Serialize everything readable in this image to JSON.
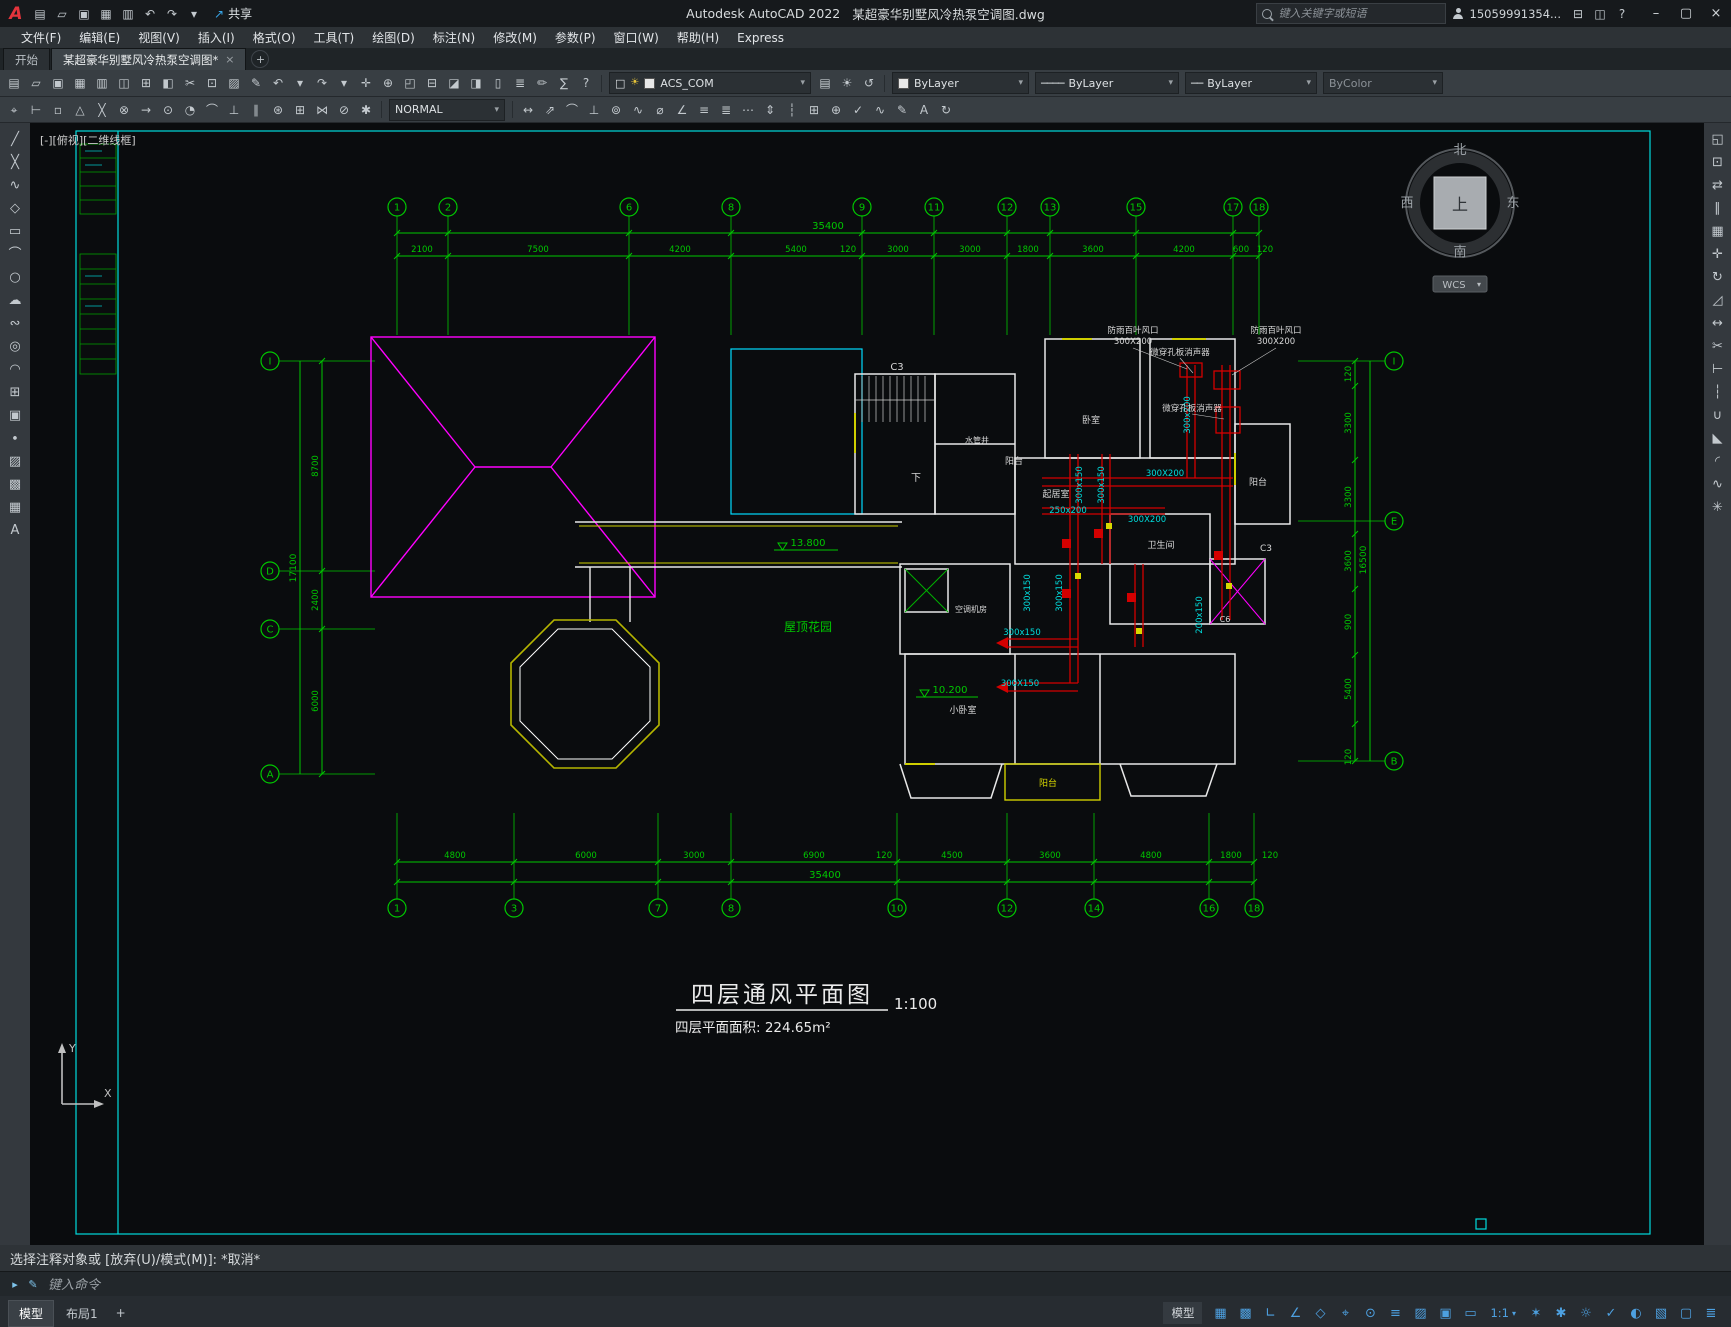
{
  "titlebar": {
    "logo_letter": "A",
    "qat_icons": [
      {
        "name": "qnew-icon",
        "glyph": "▤"
      },
      {
        "name": "open-folder-icon",
        "glyph": "▱"
      },
      {
        "name": "save-icon",
        "glyph": "▣"
      },
      {
        "name": "save-all-icon",
        "glyph": "▦"
      },
      {
        "name": "plot-icon",
        "glyph": "▥"
      },
      {
        "name": "undo-icon",
        "glyph": "↶"
      },
      {
        "name": "redo-icon",
        "glyph": "↷"
      },
      {
        "name": "qat-menu-caret-icon",
        "glyph": "▾"
      }
    ],
    "share_icon_glyph": "↗",
    "share_label": "共享",
    "app_name": "Autodesk AutoCAD 2022",
    "doc_name": "某超豪华别墅风冷热泵空调图.dwg",
    "search_placeholder": "键入关键字或短语",
    "username": "15059991354...",
    "account_icons": [
      {
        "name": "cart-icon",
        "glyph": "⊟"
      },
      {
        "name": "apps-icon",
        "glyph": "◫"
      },
      {
        "name": "help-icon",
        "glyph": "?"
      }
    ],
    "window_buttons": [
      {
        "name": "minimize-button",
        "glyph": "–"
      },
      {
        "name": "maximize-button",
        "glyph": "▢"
      },
      {
        "name": "close-button",
        "glyph": "×"
      }
    ]
  },
  "menubar": {
    "items": [
      "文件(F)",
      "编辑(E)",
      "视图(V)",
      "插入(I)",
      "格式(O)",
      "工具(T)",
      "绘图(D)",
      "标注(N)",
      "修改(M)",
      "参数(P)",
      "窗口(W)",
      "帮助(H)",
      "Express"
    ]
  },
  "filetabs": {
    "start_tab": "开始",
    "doc_tab": "某超豪华别墅风冷热泵空调图*",
    "close_glyph": "×",
    "new_tab_glyph": "+"
  },
  "toolbar1": {
    "icons": [
      {
        "name": "qnew-icon",
        "glyph": "▤"
      },
      {
        "name": "open-icon",
        "glyph": "▱"
      },
      {
        "name": "save-icon",
        "glyph": "▣"
      },
      {
        "name": "save-as-icon",
        "glyph": "▦"
      },
      {
        "name": "plot-icon",
        "glyph": "▥"
      },
      {
        "name": "plot-preview-icon",
        "glyph": "◫"
      },
      {
        "name": "publish-icon",
        "glyph": "⊞"
      },
      {
        "name": "etransmit-icon",
        "glyph": "◧"
      },
      {
        "name": "cut-icon",
        "glyph": "✂"
      },
      {
        "name": "copy-clip-icon",
        "glyph": "⊡"
      },
      {
        "name": "paste-icon",
        "glyph": "▨"
      },
      {
        "name": "match-properties-icon",
        "glyph": "✎"
      },
      {
        "name": "undo-icon",
        "glyph": "↶"
      },
      {
        "name": "undo-caret-icon",
        "glyph": "▾"
      },
      {
        "name": "redo-icon",
        "glyph": "↷"
      },
      {
        "name": "redo-caret-icon",
        "glyph": "▾"
      },
      {
        "name": "pan-icon",
        "glyph": "✛"
      },
      {
        "name": "zoom-realtime-icon",
        "glyph": "⊕"
      },
      {
        "name": "zoom-window-icon",
        "glyph": "◰"
      },
      {
        "name": "zoom-previous-icon",
        "glyph": "⊟"
      },
      {
        "name": "properties-icon",
        "glyph": "◪"
      },
      {
        "name": "designcenter-icon",
        "glyph": "◨"
      },
      {
        "name": "tool-palettes-icon",
        "glyph": "▯"
      },
      {
        "name": "sheet-set-manager-icon",
        "glyph": "≣"
      },
      {
        "name": "markup-icon",
        "glyph": "✏"
      },
      {
        "name": "quickcalc-icon",
        "glyph": "∑"
      },
      {
        "name": "help-icon",
        "glyph": "?"
      }
    ],
    "layer_combo": {
      "checkbox_glyph": "□",
      "sun_glyph": "☀",
      "label": "ACS_COM",
      "caret": "▾"
    },
    "layer_tool_icons": [
      {
        "name": "layer-properties-icon",
        "glyph": "▤"
      },
      {
        "name": "layer-states-icon",
        "glyph": "☀"
      },
      {
        "name": "layer-previous-icon",
        "glyph": "↺"
      }
    ],
    "color_combo": {
      "label": "ByLayer",
      "caret": "▾"
    },
    "linetype_combo": {
      "sample": "────",
      "label": "ByLayer",
      "caret": "▾"
    },
    "lineweight_combo": {
      "sample": "──",
      "label": "ByLayer",
      "caret": "▾"
    },
    "plotstyle_combo": {
      "label": "ByColor",
      "caret": "▾"
    }
  },
  "toolbar2": {
    "osnap_icons": [
      {
        "name": "temporary-track-icon",
        "glyph": "⌖"
      },
      {
        "name": "snap-from-icon",
        "glyph": "⊢"
      },
      {
        "name": "snap-endpoint-icon",
        "glyph": "▫"
      },
      {
        "name": "snap-midpoint-icon",
        "glyph": "△"
      },
      {
        "name": "snap-intersection-icon",
        "glyph": "╳"
      },
      {
        "name": "snap-apparent-icon",
        "glyph": "⊗"
      },
      {
        "name": "snap-extension-icon",
        "glyph": "→"
      },
      {
        "name": "snap-center-icon",
        "glyph": "⊙"
      },
      {
        "name": "snap-quadrant-icon",
        "glyph": "◔"
      },
      {
        "name": "snap-tangent-icon",
        "glyph": "⌒"
      },
      {
        "name": "snap-perpendicular-icon",
        "glyph": "⊥"
      },
      {
        "name": "snap-parallel-icon",
        "glyph": "∥"
      },
      {
        "name": "snap-node-icon",
        "glyph": "⊛"
      },
      {
        "name": "snap-insert-icon",
        "glyph": "⊞"
      },
      {
        "name": "snap-nearest-icon",
        "glyph": "⋈"
      },
      {
        "name": "snap-none-icon",
        "glyph": "⊘"
      },
      {
        "name": "osnap-settings-icon",
        "glyph": "✱"
      }
    ],
    "textstyle_combo": {
      "label": "NORMAL",
      "caret": "▾"
    },
    "dim_icons": [
      {
        "name": "dim-linear-icon",
        "glyph": "↔"
      },
      {
        "name": "dim-aligned-icon",
        "glyph": "⇗"
      },
      {
        "name": "dim-arc-length-icon",
        "glyph": "⌒"
      },
      {
        "name": "dim-ordinate-icon",
        "glyph": "⊥"
      },
      {
        "name": "dim-radius-icon",
        "glyph": "⊚"
      },
      {
        "name": "dim-jogged-icon",
        "glyph": "∿"
      },
      {
        "name": "dim-diameter-icon",
        "glyph": "⌀"
      },
      {
        "name": "dim-angular-icon",
        "glyph": "∠"
      },
      {
        "name": "quick-dim-icon",
        "glyph": "≡"
      },
      {
        "name": "dim-baseline-icon",
        "glyph": "≣"
      },
      {
        "name": "dim-continue-icon",
        "glyph": "⋯"
      },
      {
        "name": "dim-space-icon",
        "glyph": "⇕"
      },
      {
        "name": "dim-break-icon",
        "glyph": "┆"
      },
      {
        "name": "tolerance-icon",
        "glyph": "⊞"
      },
      {
        "name": "center-mark-icon",
        "glyph": "⊕"
      },
      {
        "name": "dim-inspect-icon",
        "glyph": "✓"
      },
      {
        "name": "dim-jogged-linear-icon",
        "glyph": "∿"
      },
      {
        "name": "dim-edit-icon",
        "glyph": "✎"
      },
      {
        "name": "dim-text-edit-icon",
        "glyph": "A"
      },
      {
        "name": "dim-update-icon",
        "glyph": "↻"
      }
    ]
  },
  "palettes": {
    "left": [
      {
        "name": "line-tool-icon",
        "glyph": "╱"
      },
      {
        "name": "construction-line-icon",
        "glyph": "╳"
      },
      {
        "name": "polyline-icon",
        "glyph": "∿"
      },
      {
        "name": "polygon-icon",
        "glyph": "◇"
      },
      {
        "name": "rectangle-icon",
        "glyph": "▭"
      },
      {
        "name": "arc-icon",
        "glyph": "⌒"
      },
      {
        "name": "circle-icon",
        "glyph": "○"
      },
      {
        "name": "revision-cloud-icon",
        "glyph": "☁"
      },
      {
        "name": "spline-icon",
        "glyph": "∾"
      },
      {
        "name": "ellipse-icon",
        "glyph": "◎"
      },
      {
        "name": "ellipse-arc-icon",
        "glyph": "◠"
      },
      {
        "name": "insert-block-icon",
        "glyph": "⊞"
      },
      {
        "name": "create-block-icon",
        "glyph": "▣"
      },
      {
        "name": "point-icon",
        "glyph": "∙"
      },
      {
        "name": "hatch-icon",
        "glyph": "▨"
      },
      {
        "name": "gradient-icon",
        "glyph": "▩"
      },
      {
        "name": "region-icon",
        "glyph": "▦"
      },
      {
        "name": "multiline-text-icon",
        "glyph": "A"
      }
    ],
    "right": [
      {
        "name": "erase-icon",
        "glyph": "◱"
      },
      {
        "name": "copy-icon",
        "glyph": "⊡"
      },
      {
        "name": "mirror-icon",
        "glyph": "⇄"
      },
      {
        "name": "offset-icon",
        "glyph": "∥"
      },
      {
        "name": "array-icon",
        "glyph": "▦"
      },
      {
        "name": "move-icon",
        "glyph": "✛"
      },
      {
        "name": "rotate-icon",
        "glyph": "↻"
      },
      {
        "name": "scale-icon",
        "glyph": "◿"
      },
      {
        "name": "stretch-icon",
        "glyph": "↔"
      },
      {
        "name": "trim-icon",
        "glyph": "✂"
      },
      {
        "name": "extend-icon",
        "glyph": "⊢"
      },
      {
        "name": "break-icon",
        "glyph": "┆"
      },
      {
        "name": "join-icon",
        "glyph": "∪"
      },
      {
        "name": "chamfer-icon",
        "glyph": "◣"
      },
      {
        "name": "fillet-icon",
        "glyph": "◜"
      },
      {
        "name": "blend-icon",
        "glyph": "∿"
      },
      {
        "name": "explode-icon",
        "glyph": "✳"
      }
    ]
  },
  "canvas": {
    "viewport_label": "[-][俯视][二维线框]"
  },
  "drawing": {
    "top_axis": {
      "numbers": [
        "1",
        "2",
        "6",
        "8",
        "9",
        "11",
        "12",
        "13",
        "15",
        "17",
        "18"
      ],
      "dims": [
        "2100",
        "7500",
        "4200",
        "5400",
        "120",
        "3000",
        "3000",
        "1800",
        "3600",
        "4200",
        "600",
        "120"
      ],
      "total": "35400"
    },
    "bottom_axis": {
      "numbers": [
        "1",
        "3",
        "7",
        "8",
        "10",
        "12",
        "14",
        "16",
        "18"
      ],
      "dims": [
        "4800",
        "6000",
        "3000",
        "6900",
        "120",
        "4500",
        "3600",
        "4800",
        "1800",
        "120"
      ],
      "total": "35400"
    },
    "left_axis": {
      "letters": [
        "I",
        "D",
        "C",
        "A"
      ],
      "dims": [
        "8700",
        "2400",
        "6000"
      ],
      "total": "17100"
    },
    "right_axis": {
      "letters": [
        "I",
        "E",
        "B"
      ],
      "dims": [
        "120",
        "3300",
        "3300",
        "3600",
        "900",
        "5400",
        "120"
      ],
      "total": "16500"
    },
    "duct_labels": [
      "300X200",
      "250x200",
      "300X200",
      "300x150",
      "300x150",
      "300x150",
      "300x150",
      "200x150",
      "300x200",
      "300x150",
      "300X150"
    ],
    "equipment_labels": [
      "防雨百叶风口",
      "300X200",
      "防雨百叶风口",
      "300X200",
      "微穿孔板消声器",
      "微穿孔板消声器"
    ],
    "room_labels": [
      "C3",
      "下",
      "水管井",
      "阳台",
      "起居室",
      "卧室",
      "卫生间",
      "空调机房",
      "小卧室",
      "阳台",
      "阳台",
      "C3",
      "C6"
    ],
    "garden_label": "屋顶花园",
    "elevation_upper": "13.800",
    "elevation_lower": "10.200",
    "title": "四层通风平面图",
    "scale": "1:100",
    "area": "四层平面面积: 224.65m²",
    "ucs": {
      "x_label": "X",
      "y_label": "Y"
    },
    "viewcube": {
      "top": "上",
      "north": "北",
      "south": "南",
      "east": "东",
      "west": "西",
      "wcs_label": "WCS",
      "wcs_caret": "▾"
    }
  },
  "commandline": {
    "history": "选择注释对象或 [放弃(U)/模式(M)]: *取消*",
    "placeholder": "键入命令",
    "icons": [
      {
        "name": "command-prompt-icon",
        "glyph": "▸"
      },
      {
        "name": "command-pencil-icon",
        "glyph": "✎"
      }
    ]
  },
  "statusbar": {
    "model_tab": "模型",
    "layout_tab": "布局1",
    "new_layout_glyph": "+",
    "model_button": "模型",
    "icons_a": [
      {
        "name": "grid-icon",
        "glyph": "▦"
      },
      {
        "name": "snap-mode-icon",
        "glyph": "▩"
      },
      {
        "name": "ortho-icon",
        "glyph": "∟"
      },
      {
        "name": "polar-tracking-icon",
        "glyph": "∠"
      },
      {
        "name": "isodraft-icon",
        "glyph": "◇"
      },
      {
        "name": "object-snap-tracking-icon",
        "glyph": "⌖"
      },
      {
        "name": "object-snap-icon",
        "glyph": "⊙"
      },
      {
        "name": "lineweight-display-icon",
        "glyph": "≡"
      },
      {
        "name": "transparency-icon",
        "glyph": "▨"
      },
      {
        "name": "selection-cycling-icon",
        "glyph": "▣"
      },
      {
        "name": "dynamic-input-icon",
        "glyph": "▭"
      }
    ],
    "scale_label": "1:1",
    "scale_caret": "▾",
    "icons_b": [
      {
        "name": "annotation-visibility-icon",
        "glyph": "✶"
      },
      {
        "name": "autoscale-icon",
        "glyph": "✱"
      },
      {
        "name": "workspace-switching-icon",
        "glyph": "☼"
      },
      {
        "name": "annotation-monitor-icon",
        "glyph": "✓"
      },
      {
        "name": "isolate-objects-icon",
        "glyph": "◐"
      },
      {
        "name": "graphics-performance-icon",
        "glyph": "▧"
      },
      {
        "name": "clean-screen-icon",
        "glyph": "▢"
      },
      {
        "name": "customization-icon",
        "glyph": "≣"
      }
    ]
  }
}
